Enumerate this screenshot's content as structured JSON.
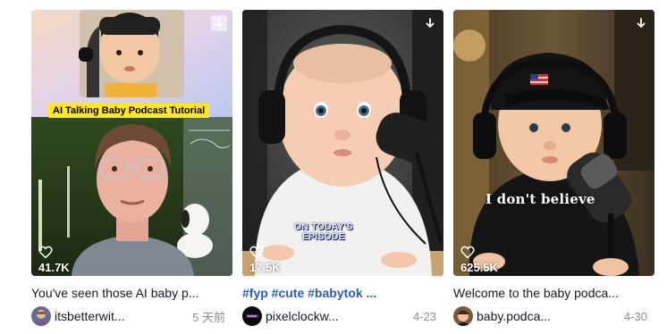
{
  "videos": [
    {
      "likes": "41.7K",
      "overlay_text": "AI Talking Baby Podcast Tutorial",
      "description": "You've seen those AI baby p...",
      "author": "itsbetterwit...",
      "date": "5 天前"
    },
    {
      "likes": "17.5K",
      "overlay_text_line1": "ON TODAY'S",
      "overlay_text_line2": "EPISODE",
      "description": "#fyp #cute #babytok ...",
      "author": "pixelclockw...",
      "date": "4-23"
    },
    {
      "likes": "625.5K",
      "overlay_text": "I don't believe",
      "description": "Welcome to the baby podca...",
      "author": "baby.podca...",
      "date": "4-30"
    }
  ],
  "icons": {
    "download": "download-arrow-icon",
    "likes": "heart-outline-icon"
  },
  "colors": {
    "hashtag": "#2b5db9",
    "date": "#8a8b91",
    "label_yellow": "#ffe81a"
  }
}
